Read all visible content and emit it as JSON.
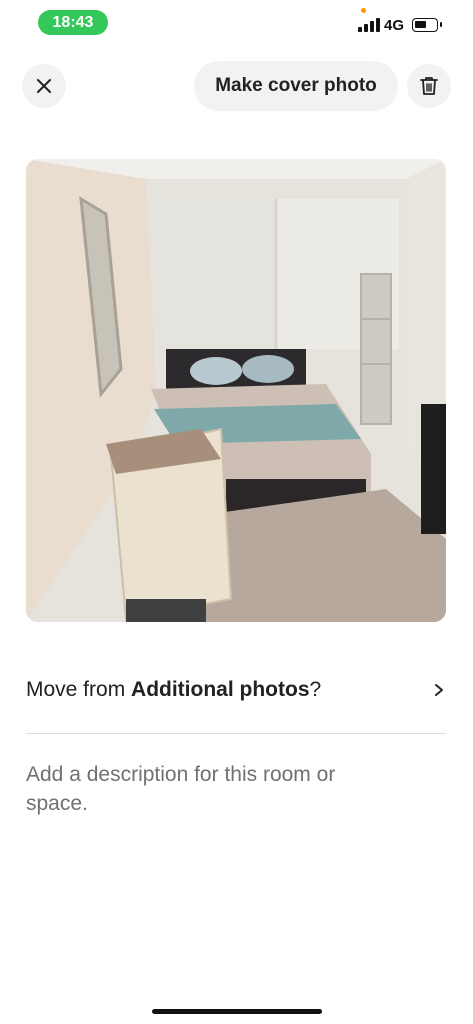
{
  "status_bar": {
    "time": "18:43",
    "network": "4G",
    "signal_bars": 4,
    "battery_level_fraction": 0.55
  },
  "toolbar": {
    "close_icon": "close-icon",
    "make_cover_label": "Make cover photo",
    "trash_icon": "trash-icon"
  },
  "photo": {
    "subject": "bedroom"
  },
  "move": {
    "prefix": "Move from ",
    "section": "Additional photos",
    "suffix": "?",
    "chevron_icon": "chevron-right-icon"
  },
  "description": {
    "placeholder": "Add a description for this room or space."
  },
  "colors": {
    "status_pill": "#34c759",
    "button_bg": "#f2f2f2",
    "text_primary": "#222222",
    "text_muted": "#717171",
    "divider": "#dddddd"
  }
}
